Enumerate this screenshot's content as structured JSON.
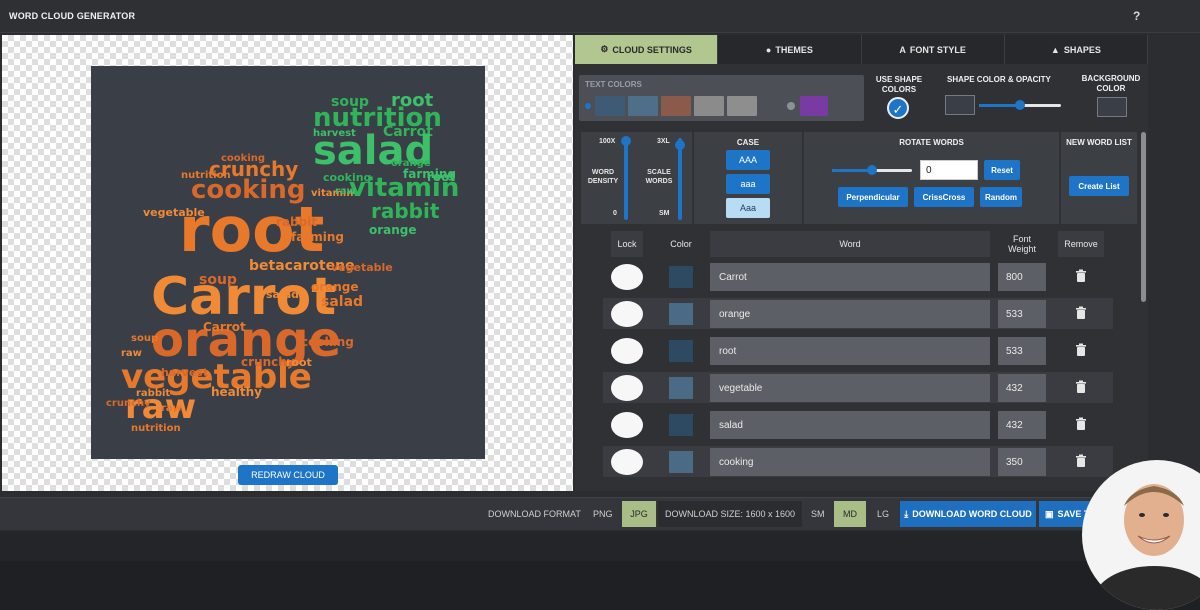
{
  "app": {
    "title": "WORD CLOUD GENERATOR",
    "help": "?"
  },
  "canvas": {
    "redraw_label": "REDRAW CLOUD"
  },
  "tabs": [
    {
      "label": "CLOUD SETTINGS",
      "icon": "gears-icon",
      "active": true
    },
    {
      "label": "THEMES",
      "icon": "palette-icon",
      "active": false
    },
    {
      "label": "FONT STYLE",
      "icon": "font-icon",
      "active": false
    },
    {
      "label": "SHAPES",
      "icon": "shapes-icon",
      "active": false
    }
  ],
  "settings": {
    "text_colors_label": "TEXT COLORS",
    "text_colors": [
      "#3e5a75",
      "#4e6e8a",
      "#8c5a4a",
      "#8b8b8b",
      "#8e8e8e"
    ],
    "alt_color": "#7a3aa3",
    "use_shape_colors_label": "USE SHAPE COLORS",
    "use_shape_colors": true,
    "shape_color_label": "SHAPE COLOR & OPACITY",
    "shape_color": "#3a3f47",
    "opacity_level": 0.5,
    "background_color_label": "BACKGROUND COLOR",
    "background_color": "#3a3f47"
  },
  "density": {
    "top": "100X",
    "label": "WORD DENSITY",
    "bottom": "0"
  },
  "scale": {
    "top": "3XL",
    "label": "SCALE WORDS",
    "bottom": "SM"
  },
  "case": {
    "label": "CASE",
    "options": [
      "AAA",
      "aaa",
      "Aaa"
    ],
    "selected": "Aaa"
  },
  "rotate": {
    "label": "ROTATE WORDS",
    "value": "0",
    "level": 0.5,
    "reset_label": "Reset",
    "buttons": [
      "Perpendicular",
      "CrissCross",
      "Random"
    ]
  },
  "new_list": {
    "label": "NEW WORD LIST",
    "button": "Create List"
  },
  "table": {
    "headers": {
      "lock": "Lock",
      "color": "Color",
      "word": "Word",
      "weight": "Font Weight",
      "remove": "Remove"
    },
    "rows": [
      {
        "word": "Carrot",
        "weight": "800",
        "color": "#2e4a63"
      },
      {
        "word": "orange",
        "weight": "533",
        "color": "#4a6a85"
      },
      {
        "word": "root",
        "weight": "533",
        "color": "#2e4a63"
      },
      {
        "word": "vegetable",
        "weight": "432",
        "color": "#4a6a85"
      },
      {
        "word": "salad",
        "weight": "432",
        "color": "#2e4a63"
      },
      {
        "word": "cooking",
        "weight": "350",
        "color": "#4a6a85"
      }
    ]
  },
  "bottom": {
    "download_format_label": "DOWNLOAD FORMAT",
    "png": "PNG",
    "jpg": "JPG",
    "download_size": "DOWNLOAD SIZE: 1600 x 1600",
    "sm": "SM",
    "md": "MD",
    "lg": "LG",
    "download_btn": "DOWNLOAD WORD CLOUD",
    "save_btn": "SAVE TO MY"
  },
  "cloud_words": {
    "carrot_shape": [
      "root",
      "Carrot",
      "orange",
      "vegetable",
      "raw",
      "cooking",
      "crunchy",
      "betacarotene",
      "soup",
      "salad",
      "healthy",
      "harvest",
      "nutrition",
      "vitamin",
      "rabbit",
      "farming",
      "vegetable",
      "crunchy",
      "Carrot",
      "raw",
      "cooking",
      "orange",
      "salad",
      "vegetable",
      "soup",
      "rabbit",
      "cooking",
      "nutrition",
      "root",
      "crunchy",
      "raw"
    ],
    "leaf_shape": [
      "soup",
      "root",
      "nutrition",
      "harvest",
      "Carrot",
      "salad",
      "vitamin",
      "farming",
      "rabbit",
      "orange",
      "cooking",
      "root",
      "orange",
      "raw"
    ]
  },
  "colors": {
    "accent_blue": "#1e74c7",
    "active_green": "#b2c68f",
    "cloud_orange": "#e8782a",
    "cloud_green": "#2fb45a"
  }
}
